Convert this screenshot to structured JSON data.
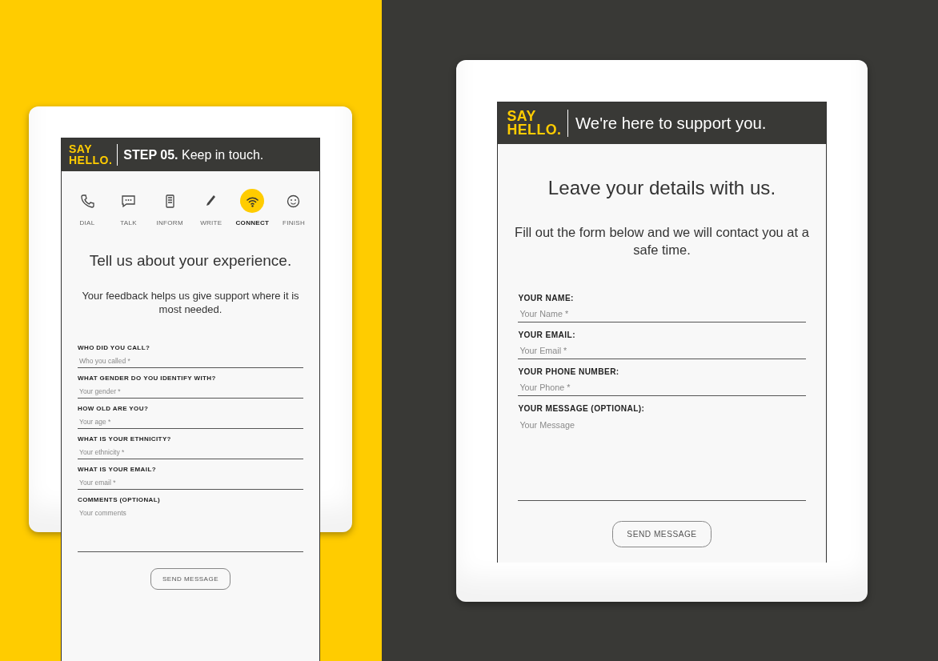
{
  "screens": [
    {
      "logo": [
        "SAY",
        "HELLO."
      ],
      "heading": "**STEP 05.** Keep in touch.",
      "steps": [
        {
          "label": "DIAL",
          "selected": false
        },
        {
          "label": "TALK",
          "selected": false
        },
        {
          "label": "INFORM",
          "selected": false
        },
        {
          "label": "WRITE",
          "selected": false
        },
        {
          "label": "CONNECT",
          "selected": true
        },
        {
          "label": "FINISH",
          "selected": false
        }
      ],
      "title": "Tell us about your experience.",
      "subtitle": "Your feedback helps us give support where it is most needed.",
      "fields": [
        {
          "kind": "line",
          "label": "WHO DID YOU CALL?",
          "placeholder": "Who you called *"
        },
        {
          "kind": "line",
          "label": "WHAT GENDER DO YOU IDENTIFY WITH?",
          "placeholder": "Your gender *"
        },
        {
          "kind": "line",
          "label": "HOW OLD ARE YOU?",
          "placeholder": "Your age *"
        },
        {
          "kind": "line",
          "label": "WHAT IS YOUR ETHNICITY?",
          "placeholder": "Your ethnicity *"
        },
        {
          "kind": "line",
          "label": "WHAT IS YOUR EMAIL?",
          "placeholder": "Your email *"
        },
        {
          "kind": "area",
          "label": "COMMENTS (OPTIONAL)",
          "placeholder": "Your comments"
        }
      ],
      "button": "SEND MESSAGE"
    },
    {
      "logo": [
        "SAY",
        "HELLO."
      ],
      "heading": "We're here to support you.",
      "title": "Leave your details with us.",
      "subtitle": "Fill out the form below and we will contact you at a safe time.",
      "fields": [
        {
          "kind": "line",
          "label": "YOUR NAME:",
          "placeholder": "Your Name *"
        },
        {
          "kind": "line",
          "label": "YOUR EMAIL:",
          "placeholder": "Your Email *"
        },
        {
          "kind": "line",
          "label": "YOUR PHONE NUMBER:",
          "placeholder": "Your Phone *"
        },
        {
          "kind": "area",
          "label": "YOUR MESSAGE (OPTIONAL):",
          "placeholder": "Your Message"
        }
      ],
      "button": "SEND MESSAGE"
    }
  ]
}
